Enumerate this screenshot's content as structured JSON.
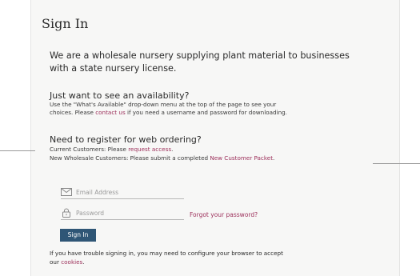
{
  "page": {
    "title": "Sign In",
    "intro": "We are a wholesale nursery supplying plant material to businesses with a state nursery license."
  },
  "availability": {
    "heading": "Just want to see an availability?",
    "line1": "Use the \"What's Available\" drop-down menu at the top of the page to see your",
    "line2_prefix": "choices. Please ",
    "contact_link": "contact us",
    "line2_suffix": " if you need a username and password for downloading."
  },
  "register": {
    "heading": "Need to register for web ordering?",
    "current_prefix": "Current Customers: Please ",
    "request_link": "request access",
    "current_suffix": ".",
    "new_prefix": "New Wholesale Customers: Please submit a completed ",
    "packet_link": "New Customer Packet",
    "new_suffix": "."
  },
  "form": {
    "email_placeholder": "Email Address",
    "password_placeholder": "Password",
    "forgot_link": "Forgot your password?",
    "signin_label": "Sign In",
    "email_icon": "envelope-icon",
    "password_icon": "lock-icon"
  },
  "footer": {
    "trouble_prefix": "If you have trouble signing in, you may need to configure your browser to accept",
    "trouble_line2_prefix": "our ",
    "cookies_link": "cookies",
    "trouble_suffix": "."
  },
  "colors": {
    "link": "#9c2f5a",
    "button": "#2f5676"
  }
}
